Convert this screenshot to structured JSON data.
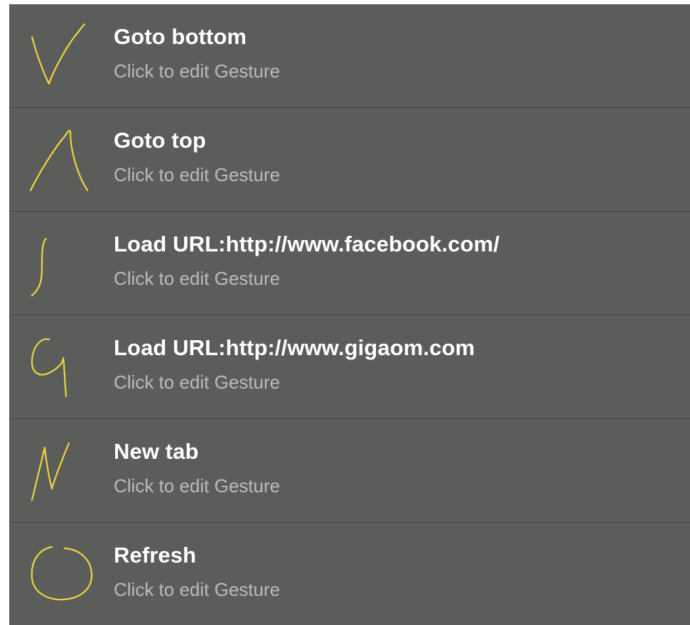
{
  "gestures": [
    {
      "icon": "check-gesture-icon",
      "title": "Goto bottom",
      "subtitle": "Click to edit Gesture"
    },
    {
      "icon": "caret-gesture-icon",
      "title": "Goto top",
      "subtitle": "Click to edit Gesture"
    },
    {
      "icon": "integral-gesture-icon",
      "title": "Load URL:http://www.facebook.com/",
      "subtitle": "Click to edit Gesture"
    },
    {
      "icon": "g-gesture-icon",
      "title": "Load URL:http://www.gigaom.com",
      "subtitle": "Click to edit Gesture"
    },
    {
      "icon": "n-gesture-icon",
      "title": "New tab",
      "subtitle": "Click to edit Gesture"
    },
    {
      "icon": "circle-gesture-icon",
      "title": "Refresh",
      "subtitle": "Click to edit Gesture"
    }
  ],
  "colors": {
    "row_background": "#5a5d59",
    "divider": "#3f423f",
    "gesture_stroke": "#efd43f",
    "title_text": "#ffffff",
    "subtitle_text": "#b9bcb8"
  }
}
